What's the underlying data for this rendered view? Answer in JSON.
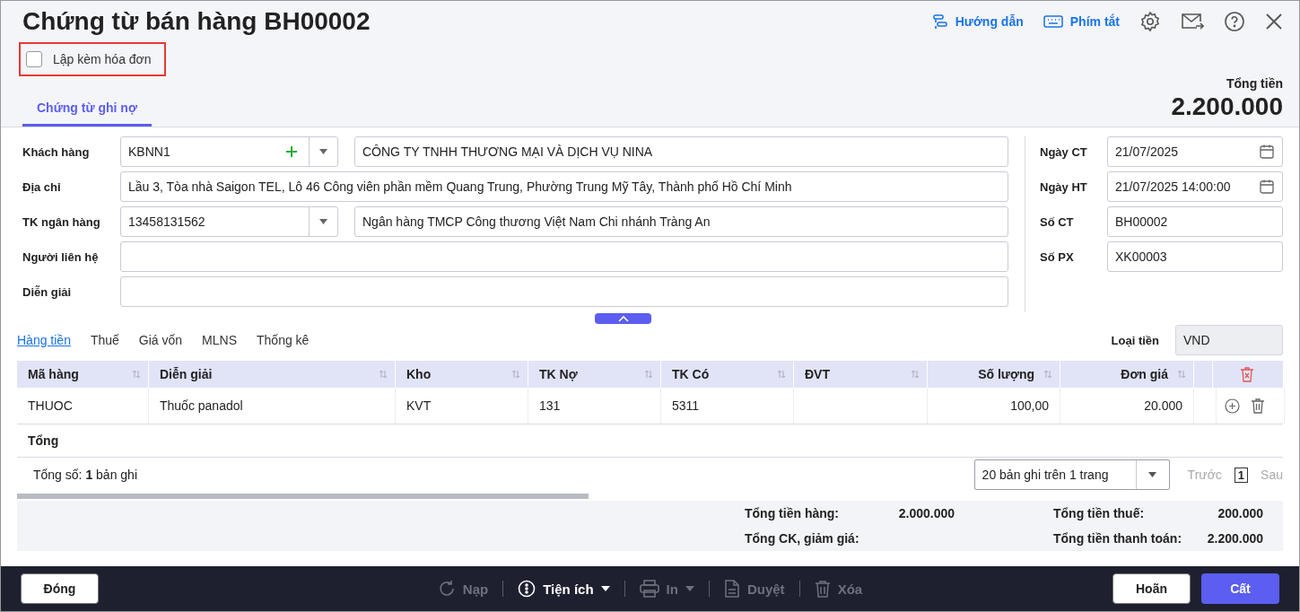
{
  "title": "Chứng từ bán hàng BH00002",
  "header_actions": [
    {
      "kind": "guide",
      "label": "Hướng dẫn"
    },
    {
      "kind": "keyboard",
      "label": "Phím tắt"
    },
    {
      "kind": "settings"
    },
    {
      "kind": "mail"
    },
    {
      "kind": "help"
    },
    {
      "kind": "close"
    }
  ],
  "invoice_checkbox": {
    "label": "Lập kèm hóa đơn",
    "checked": false
  },
  "tabs": [
    {
      "label": "Chứng từ ghi nợ",
      "selected": true
    }
  ],
  "total": {
    "label": "Tổng tiền",
    "value": "2.200.000"
  },
  "left_fields": [
    {
      "kind": "combo",
      "label": "Khách hàng",
      "code": "KBNN1",
      "add": true,
      "name": "CÔNG TY TNHH THƯƠNG MẠI VÀ DỊCH VỤ NINA"
    },
    {
      "kind": "text",
      "label": "Địa chỉ",
      "value": "Lầu 3, Tòa nhà Saigon TEL, Lô 46 Công viên phần mềm Quang Trung, Phường Trung Mỹ Tây, Thành phố Hồ Chí Minh"
    },
    {
      "kind": "combo",
      "label": "TK ngân hàng",
      "code": "13458131562",
      "add": false,
      "name": "Ngân hàng TMCP Công thương Việt Nam Chi nhánh Tràng An"
    },
    {
      "kind": "text",
      "label": "Người liên hệ"
    },
    {
      "kind": "text",
      "label": "Diễn giải"
    }
  ],
  "right_fields": [
    {
      "kind": "date",
      "label": "Ngày CT",
      "value": "21/07/2025"
    },
    {
      "kind": "date",
      "label": "Ngày HT",
      "value": "21/07/2025 14:00:00"
    },
    {
      "kind": "text",
      "label": "Số CT",
      "value": "BH00002"
    },
    {
      "kind": "text",
      "label": "Số PX",
      "value": "XK00003"
    }
  ],
  "detail_tabs": [
    {
      "label": "Hàng tiền",
      "selected": true
    },
    {
      "label": "Thuế",
      "selected": false
    },
    {
      "label": "Giá vốn",
      "selected": false
    },
    {
      "label": "MLNS",
      "selected": false
    },
    {
      "label": "Thống kê",
      "selected": false
    }
  ],
  "currency": {
    "label": "Loại tiền",
    "value": "VND"
  },
  "table": {
    "columns": [
      {
        "label": "Mã hàng"
      },
      {
        "label": "Diễn giải"
      },
      {
        "label": "Kho"
      },
      {
        "label": "TK Nợ"
      },
      {
        "label": "TK Có"
      },
      {
        "label": "ĐVT"
      },
      {
        "label": "Số lượng"
      },
      {
        "label": "Đơn giá"
      }
    ],
    "rows": [
      [
        "THUOC",
        "Thuốc panadol",
        "KVT",
        "131",
        "5311",
        "",
        "100,00",
        "20.000"
      ]
    ],
    "total_label": "Tổng"
  },
  "record_count": "Tổng số: **1** bản ghi",
  "pager": {
    "page_size": "20 bản ghi trên 1 trang",
    "prev": "Trước",
    "prev_disabled": true,
    "page": "1",
    "next": "Sau",
    "next_disabled": true
  },
  "summary": [
    {
      "label": "Tổng tiền hàng:",
      "value": "2.000.000"
    },
    {
      "label": "Tổng tiền thuế:",
      "value": "200.000"
    },
    {
      "label": "Tổng CK, giảm giá:"
    },
    {
      "label": "Tổng tiền thanh toán:",
      "value": "2.200.000"
    }
  ],
  "footer": {
    "left": [
      {
        "label": "Đóng",
        "kind": "outline"
      }
    ],
    "tools": [
      {
        "kind": "reload",
        "label": "Nạp",
        "disabled": true,
        "dropdown": false
      },
      {
        "kind": "utility",
        "label": "Tiện ích",
        "disabled": false,
        "dropdown": true
      },
      {
        "kind": "print",
        "label": "In",
        "disabled": true,
        "dropdown": true
      },
      {
        "kind": "approve",
        "label": "Duyệt",
        "disabled": true,
        "dropdown": false
      },
      {
        "kind": "delete",
        "label": "Xóa",
        "disabled": true,
        "dropdown": false
      }
    ],
    "right": [
      {
        "label": "Hoãn",
        "kind": "outline"
      },
      {
        "label": "Cất",
        "kind": "primary"
      }
    ]
  }
}
